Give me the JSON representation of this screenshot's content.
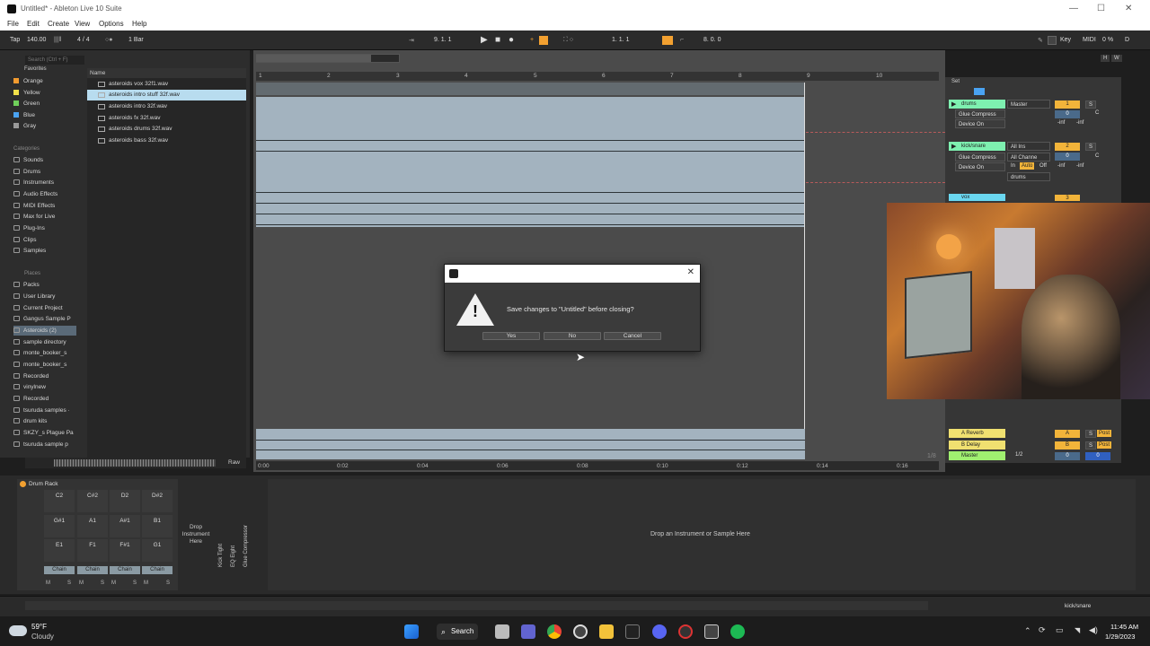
{
  "window": {
    "title": "Untitled* - Ableton Live 10 Suite"
  },
  "menu": [
    "File",
    "Edit",
    "Create",
    "View",
    "Options",
    "Help"
  ],
  "transport": {
    "tap": "Tap",
    "tempo": "140.00",
    "time_sig": "4 / 4",
    "quantize": "1 Bar",
    "arrangement_position": "9. 1. 1",
    "loop_start": "1. 1. 1",
    "loop_length": "8. 0. 0",
    "key": "Key",
    "midi": "MIDI",
    "cpu": "0 %",
    "d": "D"
  },
  "browser": {
    "search_placeholder": "Search (Ctrl + F)",
    "collections_header": "Favorites",
    "collections": [
      {
        "label": "Orange",
        "color": "#f29b2f"
      },
      {
        "label": "Yellow",
        "color": "#f2e04a"
      },
      {
        "label": "Green",
        "color": "#6fcf5a"
      },
      {
        "label": "Blue",
        "color": "#4aa3f2"
      },
      {
        "label": "Gray",
        "color": "#9a9a9a"
      }
    ],
    "categories_header": "Categories",
    "categories": [
      "Sounds",
      "Drums",
      "Instruments",
      "Audio Effects",
      "MIDI Effects",
      "Max for Live",
      "Plug-Ins",
      "Clips",
      "Samples"
    ],
    "places_header": "Places",
    "places": [
      "Packs",
      "User Library",
      "Current Project",
      "Gangus Sample P",
      "Asteroids (2)",
      "sample directory",
      "monte_booker_s",
      "monte_booker_s",
      "Recorded",
      "vinylnew",
      "Recorded",
      "tsuruda samples ·",
      "drum kits",
      "SKZY_s Plague Pa",
      "tsuruda sample p"
    ],
    "selected_place": "Asteroids (2)",
    "file_header": "Name",
    "files": [
      "asteroids vox 32f1.wav",
      "asteroids intro stuff 32f.wav",
      "asteroids intro 32f.wav",
      "asteroids fx 32f.wav",
      "asteroids drums 32f.wav",
      "asteroids bass 32f.wav"
    ],
    "selected_file": "asteroids intro stuff 32f.wav",
    "raw": "Raw"
  },
  "arrangement": {
    "bars": [
      "1",
      "2",
      "3",
      "4",
      "5",
      "6",
      "7",
      "8",
      "9",
      "10"
    ],
    "times": [
      "0:00",
      "0:02",
      "0:04",
      "0:06",
      "0:08",
      "0:10",
      "0:12",
      "0:14",
      "0:16"
    ],
    "zoom_ratio": "1/8"
  },
  "mixer": {
    "set_label": "Set",
    "tracks": [
      {
        "name": "drums",
        "color": "#7ef0b0",
        "device1": "Glue Compress",
        "device2": "Device On",
        "route": "Master",
        "number": "1",
        "vol": "0",
        "pan": "C",
        "inf1": "-inf",
        "inf2": "-inf"
      },
      {
        "name": "kick/snare",
        "color": "#7ef0b0",
        "device1": "Glue Compress",
        "device2": "Device On",
        "route": "All Ins",
        "route2": "All Channe",
        "route3": "drums",
        "number": "2",
        "vol": "0",
        "pan": "C",
        "inf1": "-inf",
        "inf2": "-inf",
        "in": "In",
        "auto": "Auto",
        "off": "Off"
      },
      {
        "name": "vox",
        "color": "#6ad7f0",
        "number": "3"
      }
    ],
    "returns": [
      {
        "name": "A Reverb",
        "letter": "A",
        "s": "S",
        "post": "Post",
        "color": "#f0e070"
      },
      {
        "name": "B Delay",
        "letter": "B",
        "s": "S",
        "post": "Post",
        "color": "#f0e070"
      },
      {
        "name": "Master",
        "route": "1/2",
        "vol": "0",
        "vol2": "0",
        "color": "#a0f070"
      }
    ]
  },
  "dialog": {
    "message": "Save changes to \"Untitled\" before closing?",
    "yes": "Yes",
    "no": "No",
    "cancel": "Cancel",
    "close_symbol": "✕"
  },
  "device": {
    "drum_rack_title": "Drum Rack",
    "pads_row1": [
      "C2",
      "C#2",
      "D2",
      "D#2"
    ],
    "pads_row2": [
      "G#1",
      "A1",
      "A#1",
      "B1"
    ],
    "pads_row3": [
      "E1",
      "F1",
      "F#1",
      "G1"
    ],
    "chain_label": "Chain",
    "m": "M",
    "s": "S",
    "drop_instrument": "Drop Instrument Here",
    "chain_devices": [
      "Kick Tight",
      "EQ Eight",
      "Glue Compressor"
    ],
    "drop_zone_text": "Drop an Instrument or Sample Here"
  },
  "status": {
    "track_name": "kick/snare"
  },
  "taskbar": {
    "weather_temp": "59°F",
    "weather_desc": "Cloudy",
    "search": "Search",
    "time": "11:45 AM",
    "date": "1/29/2023"
  }
}
